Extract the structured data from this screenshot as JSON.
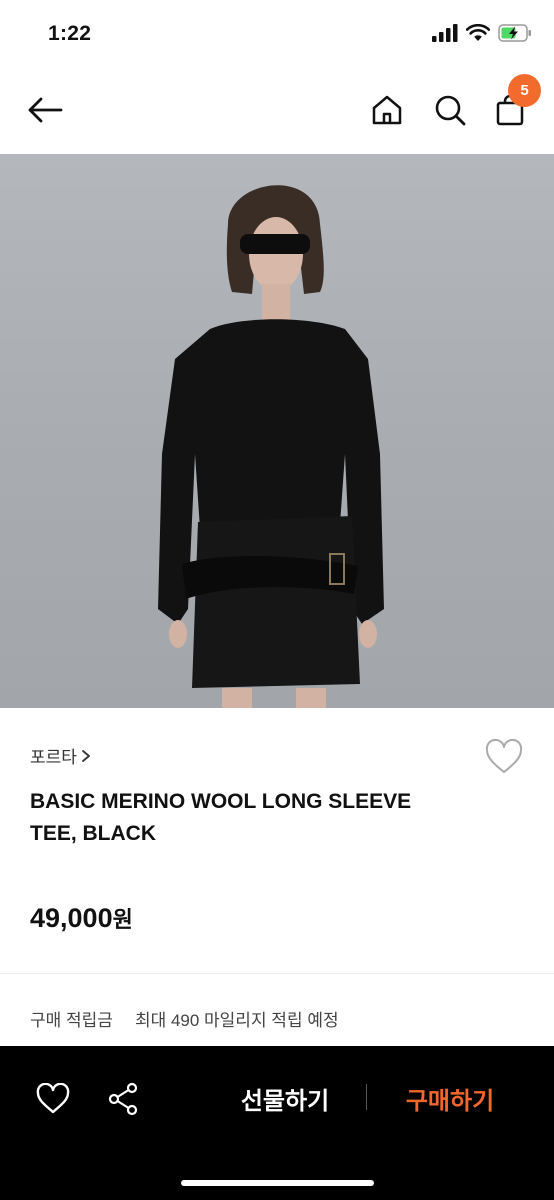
{
  "status_bar": {
    "time": "1:22"
  },
  "header": {
    "cart_count": "5"
  },
  "product": {
    "brand": "포르타",
    "title": "BASIC MERINO WOOL LONG SLEEVE TEE, BLACK",
    "price": "49,000",
    "price_unit": "원"
  },
  "points": {
    "label": "구매 적립금",
    "value": "최대 490 마일리지 적립 예정"
  },
  "bottom_bar": {
    "gift_label": "선물하기",
    "buy_label": "구매하기"
  },
  "colors": {
    "accent": "#f26b2d",
    "bottom_bar_bg": "#000000"
  }
}
